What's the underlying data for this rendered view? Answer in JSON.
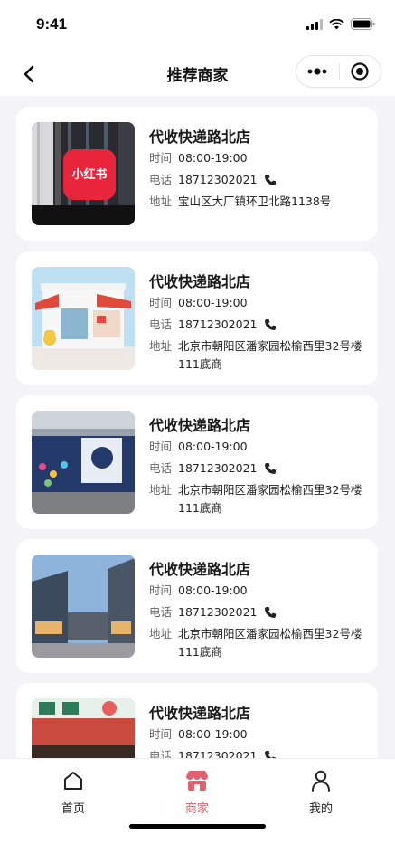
{
  "status_bar": {
    "time": "9:41"
  },
  "nav": {
    "title": "推荐商家"
  },
  "merchants": [
    {
      "name": "代收快递路北店",
      "time_label": "时间",
      "time": "08:00-19:00",
      "phone_label": "电话",
      "phone": "18712302021",
      "address_label": "地址",
      "address": "宝山区大厂镇环卫北路1138号",
      "logo_text": "小红书"
    },
    {
      "name": "代收快递路北店",
      "time_label": "时间",
      "time": "08:00-19:00",
      "phone_label": "电话",
      "phone": "18712302021",
      "address_label": "地址",
      "address": "北京市朝阳区潘家园松榆西里32号楼111底商"
    },
    {
      "name": "代收快递路北店",
      "time_label": "时间",
      "time": "08:00-19:00",
      "phone_label": "电话",
      "phone": "18712302021",
      "address_label": "地址",
      "address": "北京市朝阳区潘家园松榆西里32号楼111底商"
    },
    {
      "name": "代收快递路北店",
      "time_label": "时间",
      "time": "08:00-19:00",
      "phone_label": "电话",
      "phone": "18712302021",
      "address_label": "地址",
      "address": "北京市朝阳区潘家园松榆西里32号楼111底商"
    },
    {
      "name": "代收快递路北店",
      "time_label": "时间",
      "time": "08:00-19:00",
      "phone_label": "电话",
      "phone": "18712302021"
    }
  ],
  "tabs": [
    {
      "label": "首页",
      "icon": "home-icon"
    },
    {
      "label": "商家",
      "icon": "shop-icon",
      "active": true
    },
    {
      "label": "我的",
      "icon": "user-icon"
    }
  ],
  "colors": {
    "accent": "#e06170",
    "background": "#f4f4f6",
    "card": "#ffffff"
  }
}
